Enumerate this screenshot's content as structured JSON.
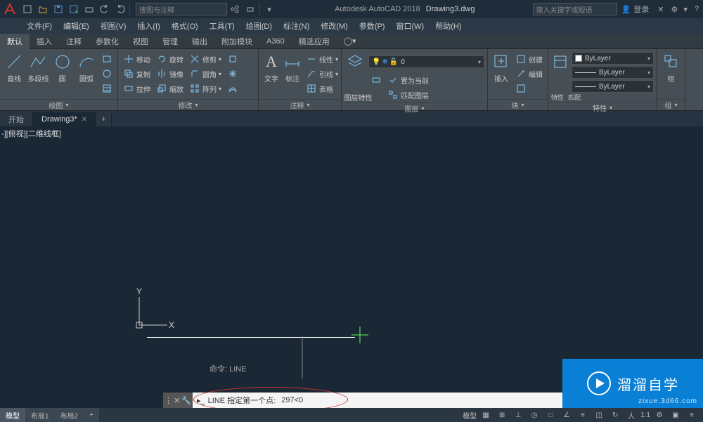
{
  "title": {
    "app": "Autodesk AutoCAD 2018",
    "doc": "Drawing3.dwg"
  },
  "qat_search_placeholder": "搜图与注释",
  "help_placeholder": "键入关键字或短语",
  "login_label": "登录",
  "menus": [
    "文件(F)",
    "编辑(E)",
    "视图(V)",
    "插入(I)",
    "格式(O)",
    "工具(T)",
    "绘图(D)",
    "标注(N)",
    "修改(M)",
    "参数(P)",
    "窗口(W)",
    "帮助(H)"
  ],
  "ribbon_tabs": [
    "默认",
    "插入",
    "注释",
    "参数化",
    "视图",
    "管理",
    "输出",
    "附加模块",
    "A360",
    "精选应用"
  ],
  "panels": {
    "draw": {
      "title": "绘图",
      "line": "直线",
      "polyline": "多段线",
      "circle": "圆",
      "arc": "圆弧"
    },
    "modify": {
      "title": "修改",
      "move": "移动",
      "rotate": "旋转",
      "trim": "修剪",
      "copy": "复制",
      "mirror": "镜像",
      "fillet": "圆角",
      "stretch": "拉伸",
      "scale": "缩放",
      "array": "阵列"
    },
    "annot": {
      "title": "注释",
      "text": "文字",
      "dim": "标注",
      "linear": "线性",
      "leader": "引线",
      "table": "表格"
    },
    "layer": {
      "title": "图层",
      "props": "图层特性",
      "current": "0",
      "setcur": "置为当前",
      "match": "匹配图层"
    },
    "block": {
      "title": "块",
      "insert": "插入",
      "create": "创建",
      "edit": "编辑"
    },
    "props": {
      "title": "特性",
      "panel": "特性",
      "match": "匹配",
      "bylayer": "ByLayer"
    },
    "group": {
      "title": "组",
      "group": "组"
    }
  },
  "filetabs": {
    "start": "开始",
    "drawing": "Drawing3*"
  },
  "viewport_label": "-][俯视][二维线框]",
  "ucs": {
    "x": "X",
    "y": "Y"
  },
  "cmd_history": "命令: LINE",
  "cmd_prompt": "LINE 指定第一个点:",
  "cmd_input": "297<0",
  "model_tabs": {
    "model": "模型",
    "layout1": "布局1",
    "layout2": "布局2"
  },
  "status": {
    "model": "模型",
    "scale": "1:1"
  },
  "watermark": {
    "main": "溜溜自学",
    "sub": "zixue.3d66.com"
  }
}
